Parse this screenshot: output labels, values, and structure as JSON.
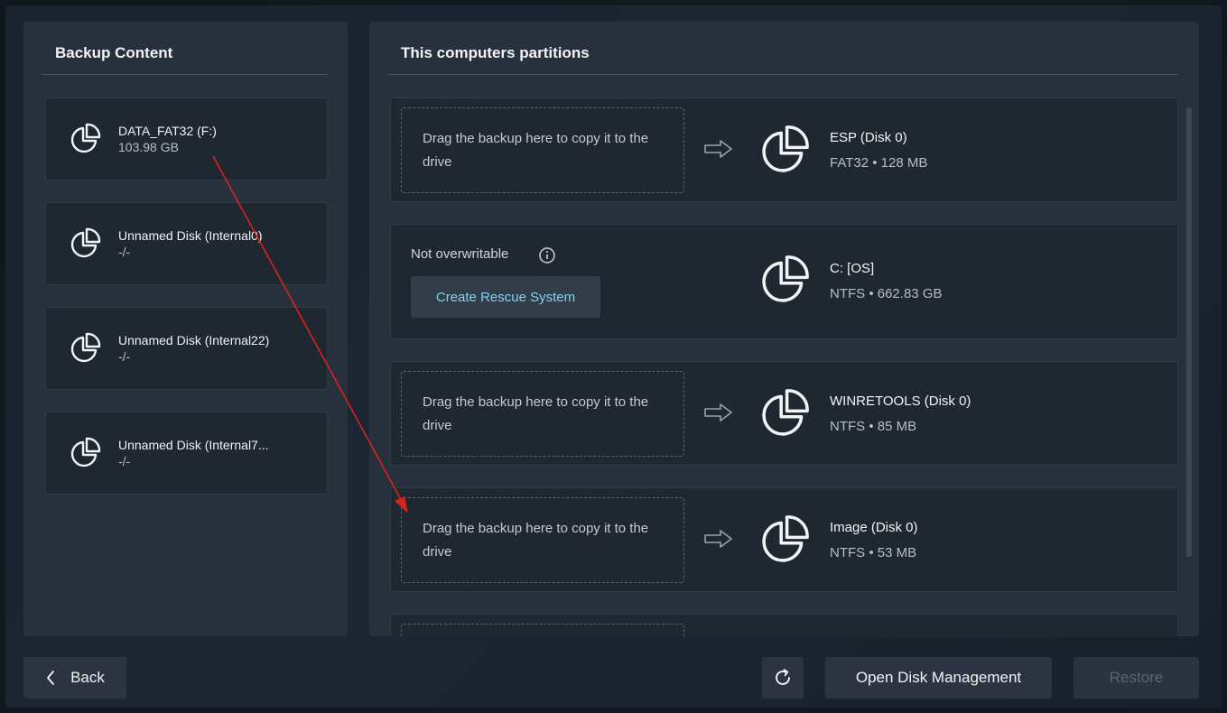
{
  "backup_panel": {
    "title": "Backup Content",
    "items": [
      {
        "name": "DATA_FAT32 (F:)",
        "sub": "103.98 GB"
      },
      {
        "name": "Unnamed Disk (Internal0)",
        "sub": "-/-"
      },
      {
        "name": "Unnamed Disk (Internal22)",
        "sub": "-/-"
      },
      {
        "name": "Unnamed Disk (Internal7...",
        "sub": "-/-"
      }
    ]
  },
  "partitions_panel": {
    "title": "This computers partitions",
    "drop_text": "Drag the backup here to copy it to the drive",
    "not_overwritable": "Not overwritable",
    "rescue_button": "Create Rescue System",
    "partitions": [
      {
        "name": "ESP (Disk 0)",
        "info": "FAT32 • 128 MB"
      },
      {
        "name": "C: [OS]",
        "info": "NTFS • 662.83 GB"
      },
      {
        "name": "WINRETOOLS (Disk 0)",
        "info": "NTFS • 85 MB"
      },
      {
        "name": "Image (Disk 0)",
        "info": "NTFS • 53 MB"
      }
    ]
  },
  "footer": {
    "back_label": "Back",
    "disk_mgmt_label": "Open Disk Management",
    "restore_label": "Restore"
  },
  "icons": {
    "partition": "pie-chart-icon",
    "arrow": "arrow-right-icon",
    "refresh": "refresh-icon",
    "back": "chevron-left-icon",
    "info": "info-icon"
  },
  "colors": {
    "accent_link": "#7fd4ec",
    "annotation_arrow": "#d8231c"
  }
}
